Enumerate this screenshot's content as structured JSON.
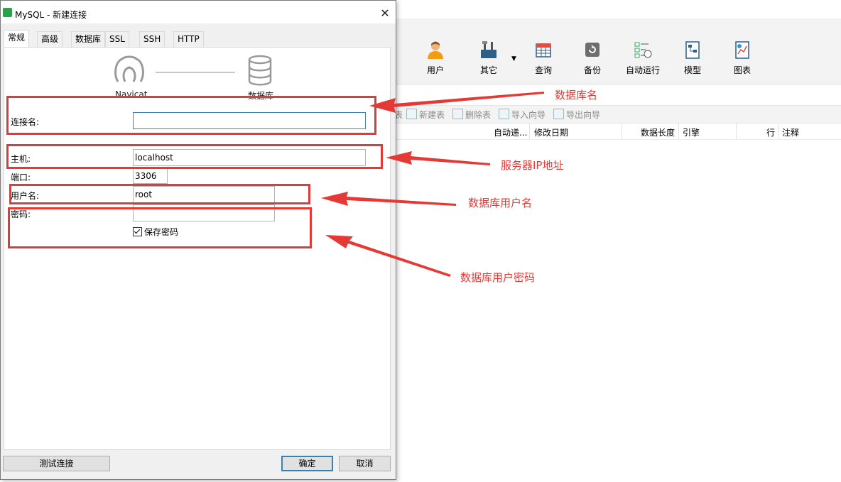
{
  "dialog": {
    "title": "MySQL - 新建连接",
    "close_glyph": "✕",
    "tabs": [
      {
        "label": "常规",
        "active": true
      },
      {
        "label": "高级"
      },
      {
        "label": "数据库"
      },
      {
        "label": "SSL"
      },
      {
        "label": "SSH"
      },
      {
        "label": "HTTP"
      }
    ],
    "illustration": {
      "left_label": "Navicat",
      "right_label": "数据库"
    },
    "fields": {
      "connection_name": {
        "label": "连接名:",
        "value": ""
      },
      "host": {
        "label": "主机:",
        "value": "localhost"
      },
      "port": {
        "label": "端口:",
        "value": "3306"
      },
      "username": {
        "label": "用户名:",
        "value": "root"
      },
      "password": {
        "label": "密码:",
        "value": ""
      }
    },
    "save_password": {
      "label": "保存密码",
      "checked": true
    },
    "buttons": {
      "test": "测试连接",
      "ok": "确定",
      "cancel": "取消"
    }
  },
  "main_window": {
    "toolbar": [
      {
        "label": "用户",
        "icon": "user-icon"
      },
      {
        "label": "其它",
        "icon": "tools-icon"
      },
      {
        "label": "查询",
        "icon": "query-icon"
      },
      {
        "label": "备份",
        "icon": "backup-icon"
      },
      {
        "label": "自动运行",
        "icon": "schedule-icon"
      },
      {
        "label": "模型",
        "icon": "model-icon"
      },
      {
        "label": "图表",
        "icon": "chart-icon"
      }
    ],
    "object_toolbar": {
      "partial": "表",
      "new_table": "新建表",
      "delete_table": "删除表",
      "import_wizard": "导入向导",
      "export_wizard": "导出向导"
    },
    "columns": {
      "auto_inc": "自动递...",
      "modified": "修改日期",
      "data_length": "数据长度",
      "engine": "引擎",
      "rows": "行",
      "comment": "注释"
    }
  },
  "annotations": {
    "db_name": "数据库名",
    "server_ip": "服务器IP地址",
    "db_user": "数据库用户名",
    "db_password": "数据库用户密码",
    "color": "#e53935"
  }
}
